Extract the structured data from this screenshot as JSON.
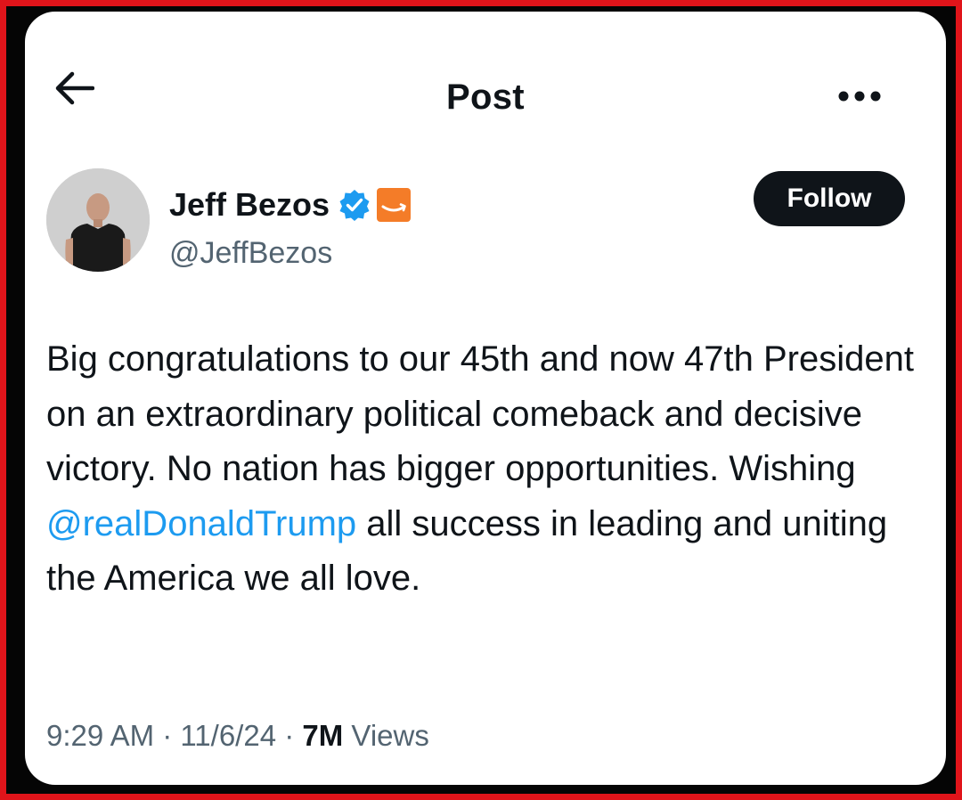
{
  "header": {
    "title": "Post",
    "back_icon": "arrow-left-icon",
    "more_icon": "more-horizontal-icon"
  },
  "author": {
    "display_name": "Jeff Bezos",
    "handle": "@JeffBezos",
    "verified_icon": "verified-badge-icon",
    "affiliate_icon": "amazon-affiliate-icon",
    "follow_label": "Follow"
  },
  "post": {
    "text_before_mention": "Big congratulations to our 45th and now 47th President on an extraordinary political comeback and decisive victory. No nation has bigger opportunities. Wishing ",
    "mention": "@realDonaldTrump",
    "text_after_mention": " all success in leading and uniting the America we all love."
  },
  "meta": {
    "time": "9:29 AM",
    "separator": " · ",
    "date": "11/6/24",
    "views_count": "7M",
    "views_label": " Views"
  },
  "colors": {
    "frame_red": "#e0141a",
    "verified_blue": "#1d9bf0",
    "amazon_orange": "#f47c28",
    "text_primary": "#0f1419",
    "text_secondary": "#536471"
  }
}
